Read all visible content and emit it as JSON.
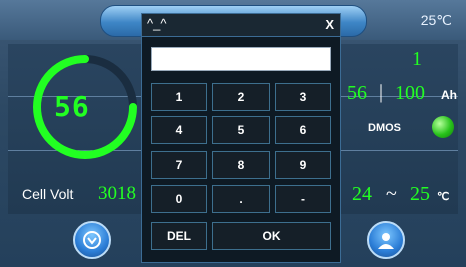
{
  "header": {
    "temperature": "25℃"
  },
  "dashboard": {
    "soc_value": "56",
    "cell_count": "1",
    "capacity_remaining": "56",
    "capacity_separator": "|",
    "capacity_total": "100",
    "capacity_unit": "Ah",
    "dmos_label": "DMOS",
    "cell_volt_label": "Cell Volt",
    "cell_volt_value": "3018",
    "temp_min": "24",
    "temp_separator": "~",
    "temp_max": "25",
    "temp_unit": "℃"
  },
  "keypad": {
    "title": "^_^",
    "close_label": "X",
    "input_value": "",
    "keys": [
      "1",
      "2",
      "3",
      "4",
      "5",
      "6",
      "7",
      "8",
      "9",
      "0",
      ".",
      "-"
    ],
    "del_label": "DEL",
    "ok_label": "OK"
  },
  "colors": {
    "accent_green": "#22ff22",
    "panel_blue": "#2a4560",
    "led_green": "#27c21a"
  },
  "icons": {
    "left_button": "chevron-down-icon",
    "right_button": "user-icon"
  }
}
